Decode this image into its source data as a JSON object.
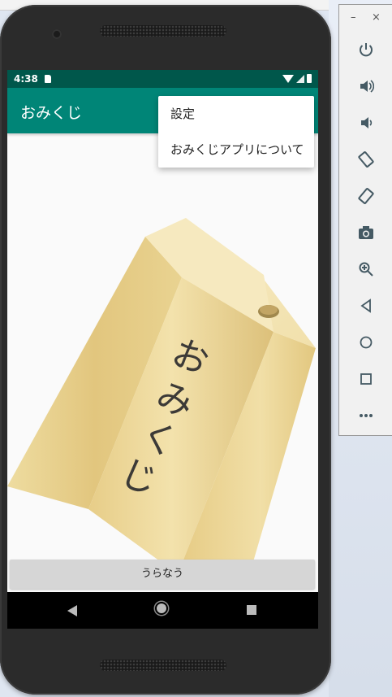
{
  "status_bar": {
    "time": "4:38"
  },
  "app_bar": {
    "title": "おみくじ"
  },
  "overflow_menu": {
    "items": [
      {
        "label": "設定"
      },
      {
        "label": "おみくじアプリについて"
      }
    ]
  },
  "illustration": {
    "text": "おみくじ"
  },
  "fortune_button": {
    "label": "うらなう"
  },
  "emulator_toolbar": {
    "minimize": "–",
    "close": "×",
    "buttons": [
      "power-icon",
      "volume-up-icon",
      "volume-down-icon",
      "rotate-left-icon",
      "rotate-right-icon",
      "camera-icon",
      "zoom-icon",
      "back-icon",
      "home-icon",
      "overview-icon",
      "more-icon"
    ]
  },
  "colors": {
    "status_bar": "#00574b",
    "app_bar": "#008577",
    "menu_bg": "#ffffff",
    "button_bg": "#d6d6d6"
  }
}
